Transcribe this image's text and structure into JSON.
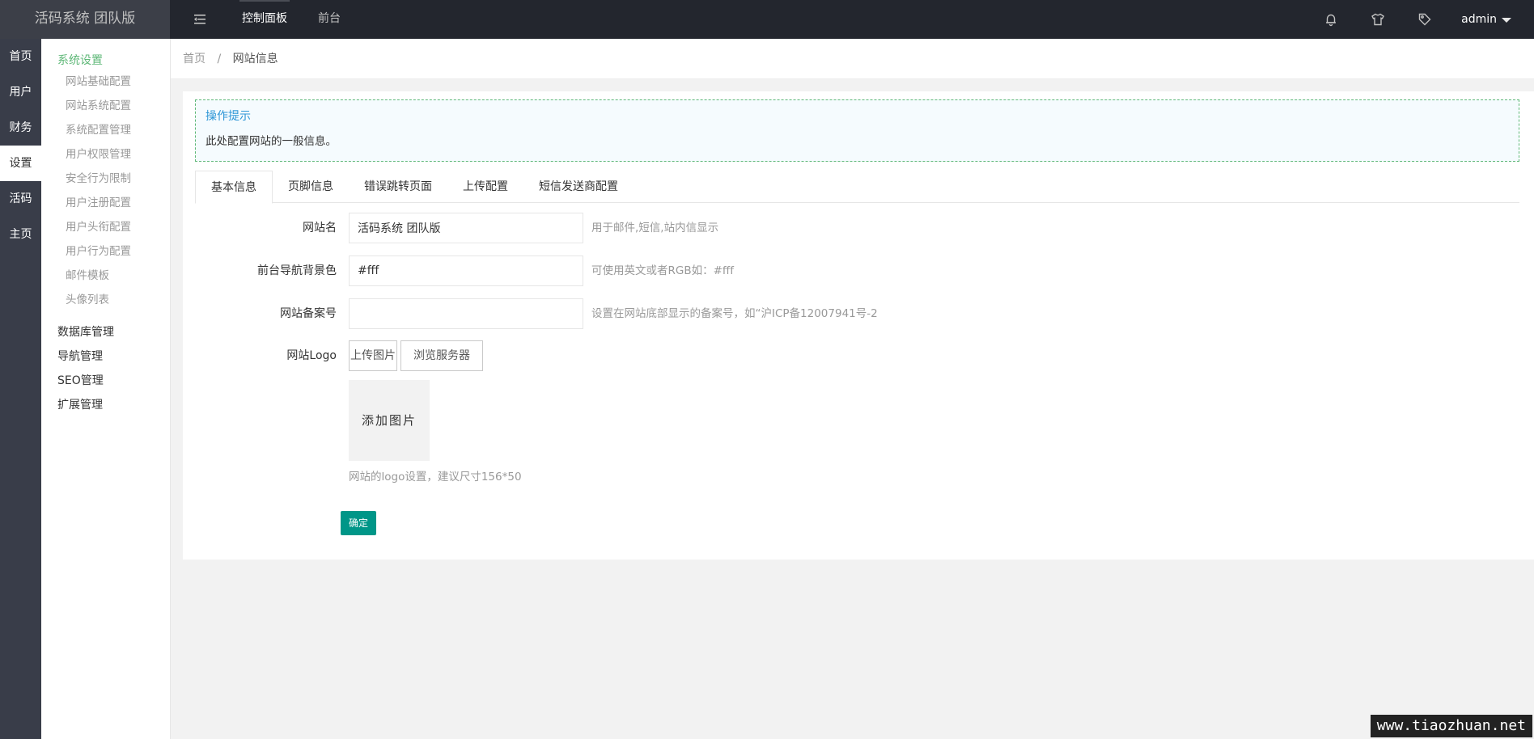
{
  "header": {
    "logo": "活码系统 团队版",
    "nav": [
      {
        "label": "控制面板"
      },
      {
        "label": "前台"
      }
    ],
    "user": "admin"
  },
  "mainnav": [
    {
      "label": "首页"
    },
    {
      "label": "用户"
    },
    {
      "label": "财务"
    },
    {
      "label": "设置"
    },
    {
      "label": "活码"
    },
    {
      "label": "主页"
    }
  ],
  "subnav": {
    "group_title": "系统设置",
    "items": [
      {
        "label": "网站基础配置"
      },
      {
        "label": "网站系统配置"
      },
      {
        "label": "系统配置管理"
      },
      {
        "label": "用户权限管理"
      },
      {
        "label": "安全行为限制"
      },
      {
        "label": "用户注册配置"
      },
      {
        "label": "用户头衔配置"
      },
      {
        "label": "用户行为配置"
      },
      {
        "label": "邮件模板"
      },
      {
        "label": "头像列表"
      }
    ],
    "sections": [
      {
        "label": "数据库管理"
      },
      {
        "label": "导航管理"
      },
      {
        "label": "SEO管理"
      },
      {
        "label": "扩展管理"
      }
    ]
  },
  "breadcrumb": {
    "home": "首页",
    "separator": "/",
    "current": "网站信息"
  },
  "tip": {
    "title": "操作提示",
    "text": "此处配置网站的一般信息。"
  },
  "tabs": [
    {
      "label": "基本信息"
    },
    {
      "label": "页脚信息"
    },
    {
      "label": "错误跳转页面"
    },
    {
      "label": "上传配置"
    },
    {
      "label": "短信发送商配置"
    }
  ],
  "form": {
    "site_name": {
      "label": "网站名",
      "value": "活码系统 团队版",
      "hint": "用于邮件,短信,站内信显示"
    },
    "nav_bg": {
      "label": "前台导航背景色",
      "value": "#fff",
      "hint": "可使用英文或者RGB如：#fff"
    },
    "icp": {
      "label": "网站备案号",
      "value": "",
      "hint": "设置在网站底部显示的备案号，如“沪ICP备12007941号-2"
    },
    "logo": {
      "label": "网站Logo",
      "upload_label": "上传图片",
      "browse_label": "浏览服务器",
      "add_image": "添加图片",
      "hint": "网站的logo设置，建议尺寸156*50"
    },
    "submit_label": "确定"
  },
  "watermark": "www.tiaozhuan.net",
  "colors": {
    "header_bg": "#23262e",
    "sidebar_bg": "#393d49",
    "accent_green": "#5fb878",
    "primary_button": "#009688",
    "tip_title": "#2d96d6"
  }
}
